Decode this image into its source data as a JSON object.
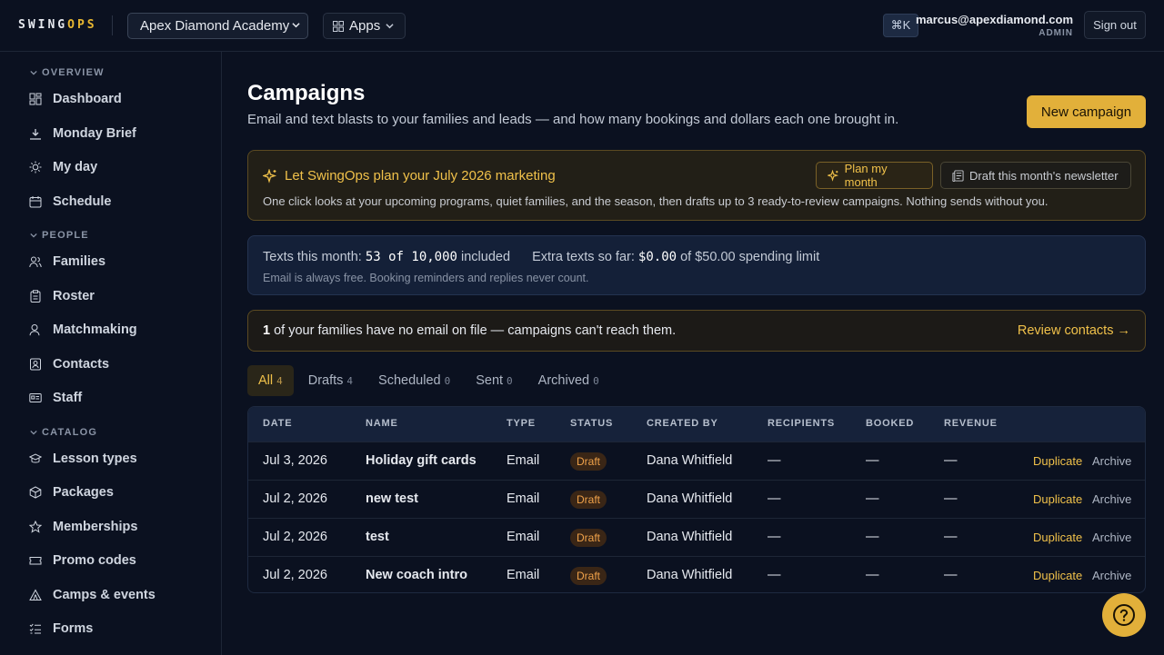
{
  "brand": {
    "part1": "SWING",
    "part2": "OPS"
  },
  "topbar": {
    "org": "Apex Diamond Academy",
    "apps_label": "Apps",
    "cmd_shortcut": "⌘K",
    "user_email": "marcus@apexdiamond.com",
    "user_role": "ADMIN",
    "signout_label": "Sign out"
  },
  "sidebar": {
    "sections": [
      {
        "label": "OVERVIEW",
        "items": [
          {
            "label": "Dashboard",
            "icon": "dashboard-icon"
          },
          {
            "label": "Monday Brief",
            "icon": "brief-icon"
          },
          {
            "label": "My day",
            "icon": "sun-icon"
          },
          {
            "label": "Schedule",
            "icon": "calendar-icon"
          }
        ]
      },
      {
        "label": "PEOPLE",
        "items": [
          {
            "label": "Families",
            "icon": "users-icon"
          },
          {
            "label": "Roster",
            "icon": "clipboard-icon"
          },
          {
            "label": "Matchmaking",
            "icon": "match-icon"
          },
          {
            "label": "Contacts",
            "icon": "contact-icon"
          },
          {
            "label": "Staff",
            "icon": "id-card-icon"
          }
        ]
      },
      {
        "label": "CATALOG",
        "items": [
          {
            "label": "Lesson types",
            "icon": "graduation-icon"
          },
          {
            "label": "Packages",
            "icon": "package-icon"
          },
          {
            "label": "Memberships",
            "icon": "star-icon"
          },
          {
            "label": "Promo codes",
            "icon": "ticket-icon"
          },
          {
            "label": "Camps & events",
            "icon": "tent-icon"
          },
          {
            "label": "Forms",
            "icon": "list-check-icon"
          }
        ]
      }
    ]
  },
  "page": {
    "title": "Campaigns",
    "subtitle": "Email and text blasts to your families and leads — and how many bookings and dollars each one brought in.",
    "new_button": "New campaign"
  },
  "ai_banner": {
    "title": "Let SwingOps plan your July 2026 marketing",
    "description": "One click looks at your upcoming programs, quiet families, and the season, then drafts up to 3 ready-to-review campaigns. Nothing sends without you.",
    "plan_button": "Plan my month",
    "draft_button": "Draft this month's newsletter"
  },
  "usage": {
    "texts_label": "Texts this month:",
    "texts_value": "53 of 10,000",
    "texts_suffix": "included",
    "extra_label": "Extra texts so far:",
    "extra_value": "$0.00",
    "extra_suffix": "of $50.00 spending limit",
    "note": "Email is always free. Booking reminders and replies never count."
  },
  "warning": {
    "count": "1",
    "text": " of your families have no email on file — campaigns can't reach them.",
    "link": "Review contacts →"
  },
  "tabs": [
    {
      "label": "All",
      "count": "4",
      "active": true
    },
    {
      "label": "Drafts",
      "count": "4"
    },
    {
      "label": "Scheduled",
      "count": "0"
    },
    {
      "label": "Sent",
      "count": "0"
    },
    {
      "label": "Archived",
      "count": "0"
    }
  ],
  "table": {
    "headers": [
      "DATE",
      "NAME",
      "TYPE",
      "STATUS",
      "CREATED BY",
      "RECIPIENTS",
      "BOOKED",
      "REVENUE"
    ],
    "rows": [
      {
        "date": "Jul 3, 2026",
        "name": "Holiday gift cards",
        "type": "Email",
        "status": "Draft",
        "created_by": "Dana Whitfield",
        "recipients": "—",
        "booked": "—",
        "revenue": "—",
        "dup": "Duplicate",
        "arc": "Archive"
      },
      {
        "date": "Jul 2, 2026",
        "name": "new test",
        "type": "Email",
        "status": "Draft",
        "created_by": "Dana Whitfield",
        "recipients": "—",
        "booked": "—",
        "revenue": "—",
        "dup": "Duplicate",
        "arc": "Archive"
      },
      {
        "date": "Jul 2, 2026",
        "name": "test",
        "type": "Email",
        "status": "Draft",
        "created_by": "Dana Whitfield",
        "recipients": "—",
        "booked": "—",
        "revenue": "—",
        "dup": "Duplicate",
        "arc": "Archive"
      },
      {
        "date": "Jul 2, 2026",
        "name": "New coach intro",
        "type": "Email",
        "status": "Draft",
        "created_by": "Dana Whitfield",
        "recipients": "—",
        "booked": "—",
        "revenue": "—",
        "dup": "Duplicate",
        "arc": "Archive"
      }
    ]
  },
  "colors": {
    "accent": "#e2b03a",
    "background": "#0b1120",
    "draft_badge": "#f0a24a"
  }
}
